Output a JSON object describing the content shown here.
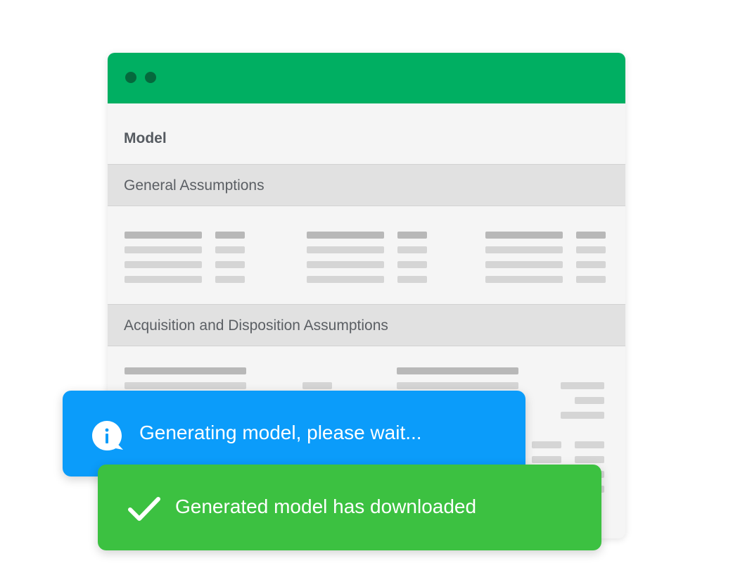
{
  "window": {
    "title": "Model",
    "sections": [
      {
        "label": "General Assumptions"
      },
      {
        "label": "Acquisition and Disposition Assumptions"
      }
    ]
  },
  "notifications": {
    "info": {
      "message": "Generating model, please wait...",
      "icon": "info-icon"
    },
    "success": {
      "message": "Generated model has downloaded",
      "icon": "checkmark-icon"
    }
  },
  "colors": {
    "titlebar": "#00af62",
    "info_toast": "#0b9cfa",
    "success_toast": "#3cc141"
  }
}
